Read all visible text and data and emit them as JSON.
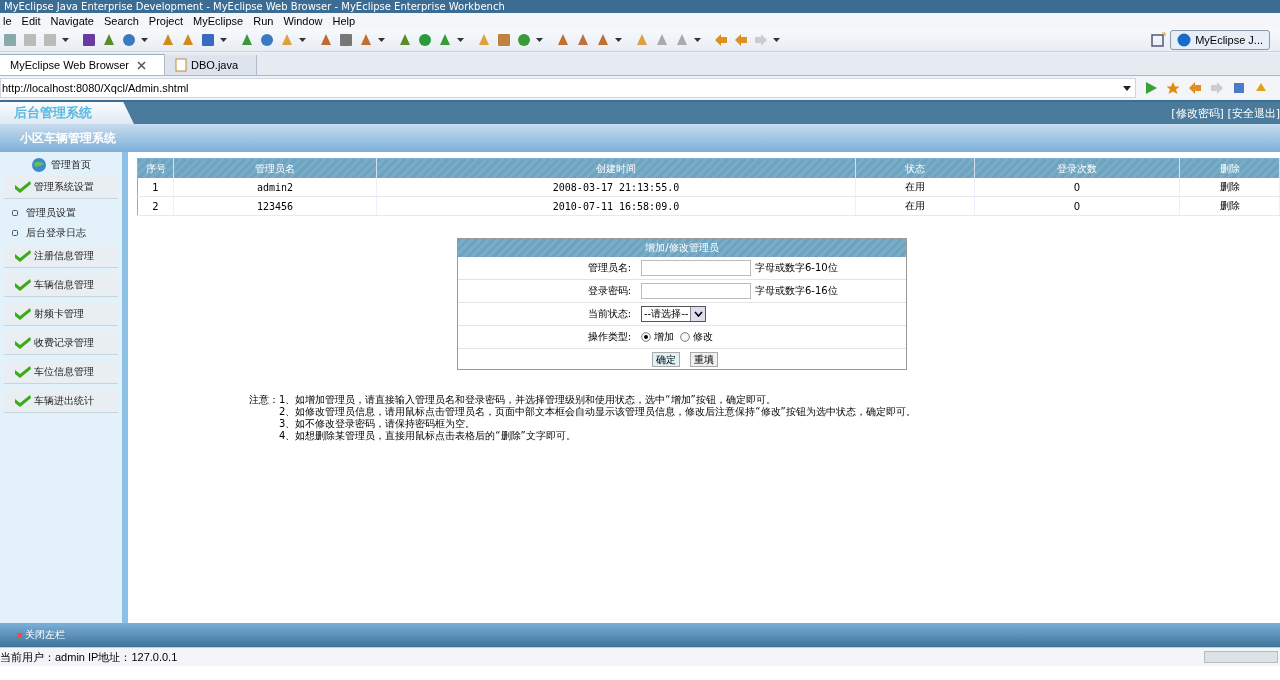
{
  "window": {
    "title": "MyEclipse Java Enterprise Development - MyEclipse Web Browser - MyEclipse Enterprise Workbench"
  },
  "menu": [
    "le",
    "Edit",
    "Navigate",
    "Search",
    "Project",
    "MyEclipse",
    "Run",
    "Window",
    "Help"
  ],
  "perspective": {
    "label": "MyEclipse J..."
  },
  "tabs": [
    {
      "label": "MyEclipse Web Browser",
      "selected": true,
      "closable": true
    },
    {
      "label": "DBO.java",
      "selected": false,
      "closable": false
    }
  ],
  "url": "http://localhost:8080/Xqcl/Admin.shtml",
  "page": {
    "logo": "后台管理系统",
    "top_links": "[修改密码] [安全退出]",
    "system_name": "小区车辆管理系统",
    "sidebar": {
      "home": "管理首页",
      "items": [
        {
          "label": "管理系统设置",
          "children": [
            {
              "label": "管理员设置"
            },
            {
              "label": "后台登录日志"
            }
          ]
        },
        {
          "label": "注册信息管理"
        },
        {
          "label": "车辆信息管理"
        },
        {
          "label": "射频卡管理"
        },
        {
          "label": "收费记录管理"
        },
        {
          "label": "车位信息管理"
        },
        {
          "label": "车辆进出统计"
        }
      ]
    },
    "table": {
      "columns": [
        "序号",
        "管理员名",
        "创建时间",
        "状态",
        "登录次数",
        "删除"
      ],
      "rows": [
        [
          "1",
          "admin2",
          "2008-03-17 21:13:55.0",
          "在用",
          "0",
          "删除"
        ],
        [
          "2",
          "123456",
          "2010-07-11 16:58:09.0",
          "在用",
          "0",
          "删除"
        ]
      ]
    },
    "form": {
      "title": "增加/修改管理员",
      "fields": [
        {
          "kind": "text",
          "label": "管理员名:",
          "hint": "字母或数字6-10位"
        },
        {
          "kind": "text",
          "label": "登录密码:",
          "hint": "字母或数字6-16位"
        },
        {
          "kind": "select",
          "label": "当前状态:",
          "value": "--请选择--"
        },
        {
          "kind": "radio",
          "label": "操作类型:",
          "options": [
            {
              "label": "增加",
              "selected": true
            },
            {
              "label": "修改",
              "selected": false
            }
          ]
        }
      ],
      "buttons": [
        "确定",
        "重填"
      ]
    },
    "notes": [
      "注意：1、如增加管理员，请直接输入管理员名和登录密码，并选择管理级别和使用状态，选中“增加”按钮，确定即可。",
      "2、如修改管理员信息，请用鼠标点击管理员名，页面中部文本框会自动显示该管理员信息，修改后注意保持“修改”按钮为选中状态，确定即可。",
      "3、如不修改登录密码，请保持密码框为空。",
      "4、如想删除某管理员，直接用鼠标点击表格后的“删除”文字即可。"
    ],
    "close_sidebar": "关闭左栏",
    "status": "当前用户：admin  IP地址：127.0.0.1"
  }
}
